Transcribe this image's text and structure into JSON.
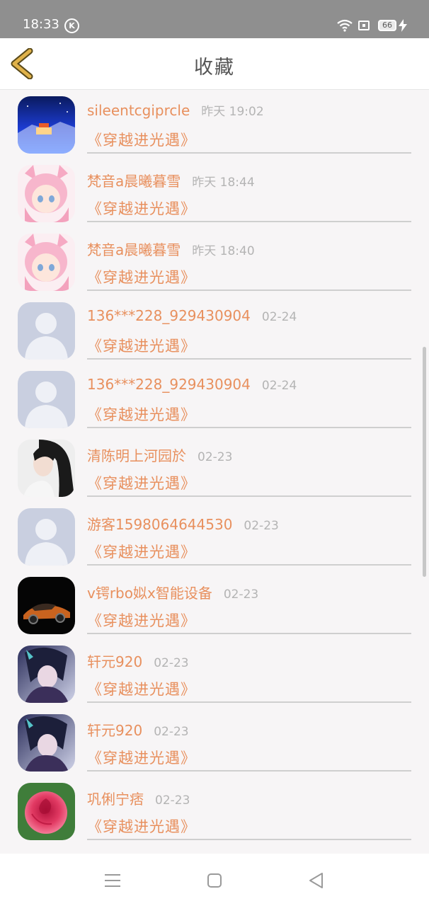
{
  "status_bar": {
    "time": "18:33",
    "k_badge": "K",
    "battery": "66"
  },
  "header": {
    "title": "收藏"
  },
  "colors": {
    "accent": "#e8905e",
    "back_arrow": "#e0b24a",
    "time_gray": "#b4b4b4"
  },
  "rows": [
    {
      "user": "sileentcgiprcle",
      "time": "昨天 19:02",
      "title": "《穿越进光遇》",
      "avatar": "night-scene"
    },
    {
      "user": "梵音a晨曦暮雪",
      "time": "昨天 18:44",
      "title": "《穿越进光遇》",
      "avatar": "pink-anime-girl"
    },
    {
      "user": "梵音a晨曦暮雪",
      "time": "昨天 18:40",
      "title": "《穿越进光遇》",
      "avatar": "pink-anime-girl"
    },
    {
      "user": "136***228_929430904",
      "time": "02-24",
      "title": "《穿越进光遇》",
      "avatar": "default-person"
    },
    {
      "user": "136***228_929430904",
      "time": "02-24",
      "title": "《穿越进光遇》",
      "avatar": "default-person"
    },
    {
      "user": "清陈明上河园於",
      "time": "02-23",
      "title": "《穿越进光遇》",
      "avatar": "dark-hair-girl"
    },
    {
      "user": "游客1598064644530",
      "time": "02-23",
      "title": "《穿越进光遇》",
      "avatar": "default-person"
    },
    {
      "user": "v锷rbo姒x智能设备",
      "time": "02-23",
      "title": "《穿越进光遇》",
      "avatar": "sports-car"
    },
    {
      "user": "轩元920",
      "time": "02-23",
      "title": "《穿越进光遇》",
      "avatar": "dark-anime-boy"
    },
    {
      "user": "轩元920",
      "time": "02-23",
      "title": "《穿越进光遇》",
      "avatar": "dark-anime-boy"
    },
    {
      "user": "巩俐宁痞",
      "time": "02-23",
      "title": "《穿越进光遇》",
      "avatar": "pink-rose"
    }
  ]
}
